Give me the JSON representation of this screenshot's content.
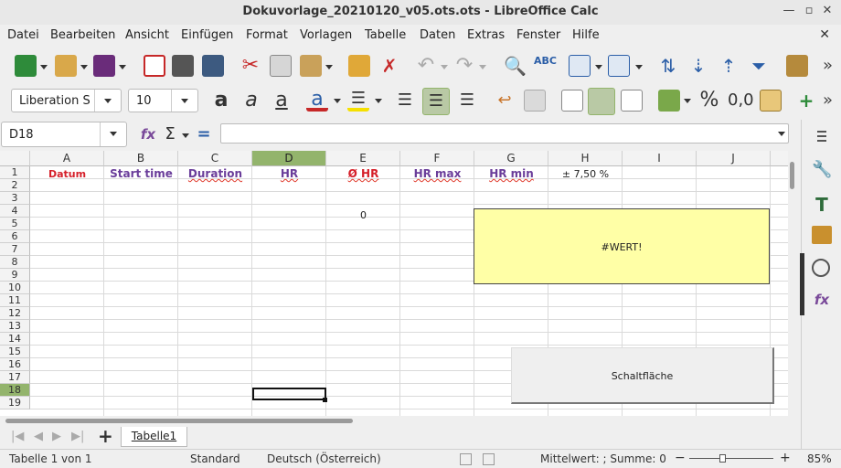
{
  "window": {
    "title": "Dokuvorlage_20210120_v05.ots.ots - LibreOffice Calc"
  },
  "menu": [
    "Datei",
    "Bearbeiten",
    "Ansicht",
    "Einfügen",
    "Format",
    "Vorlagen",
    "Tabelle",
    "Daten",
    "Extras",
    "Fenster",
    "Hilfe"
  ],
  "formatting": {
    "font_name": "Liberation S",
    "font_size": "10"
  },
  "formula_bar": {
    "name_box": "D18",
    "formula": ""
  },
  "columns": [
    "A",
    "B",
    "C",
    "D",
    "E",
    "F",
    "G",
    "H",
    "I",
    "J"
  ],
  "selected_column": "D",
  "rows": [
    "1",
    "2",
    "3",
    "4",
    "5",
    "6",
    "7",
    "8",
    "9",
    "10",
    "11",
    "12",
    "13",
    "14",
    "15",
    "16",
    "17",
    "18",
    "19"
  ],
  "selected_row": "18",
  "header_row": {
    "a": "Datum",
    "b": "Start time",
    "c": "Duration",
    "d": "HR",
    "e": "Ø HR",
    "f": "HR max",
    "g": "HR min",
    "h": "± 7,50  %"
  },
  "cells": {
    "e4": "0"
  },
  "textbox": {
    "text": "#WERT!"
  },
  "button": {
    "label": "Schaltfläche"
  },
  "sheet_tab": "Tabelle1",
  "status": {
    "sheet": "Tabelle 1 von 1",
    "style": "Standard",
    "language": "Deutsch (Österreich)",
    "summary": "Mittelwert: ; Summe: 0",
    "zoom": "85%"
  },
  "colors": {
    "accent_selection": "#93b46c",
    "header_red": "#d5202a",
    "header_purple": "#6a3d9a",
    "textbox_fill": "#ffffa6"
  }
}
